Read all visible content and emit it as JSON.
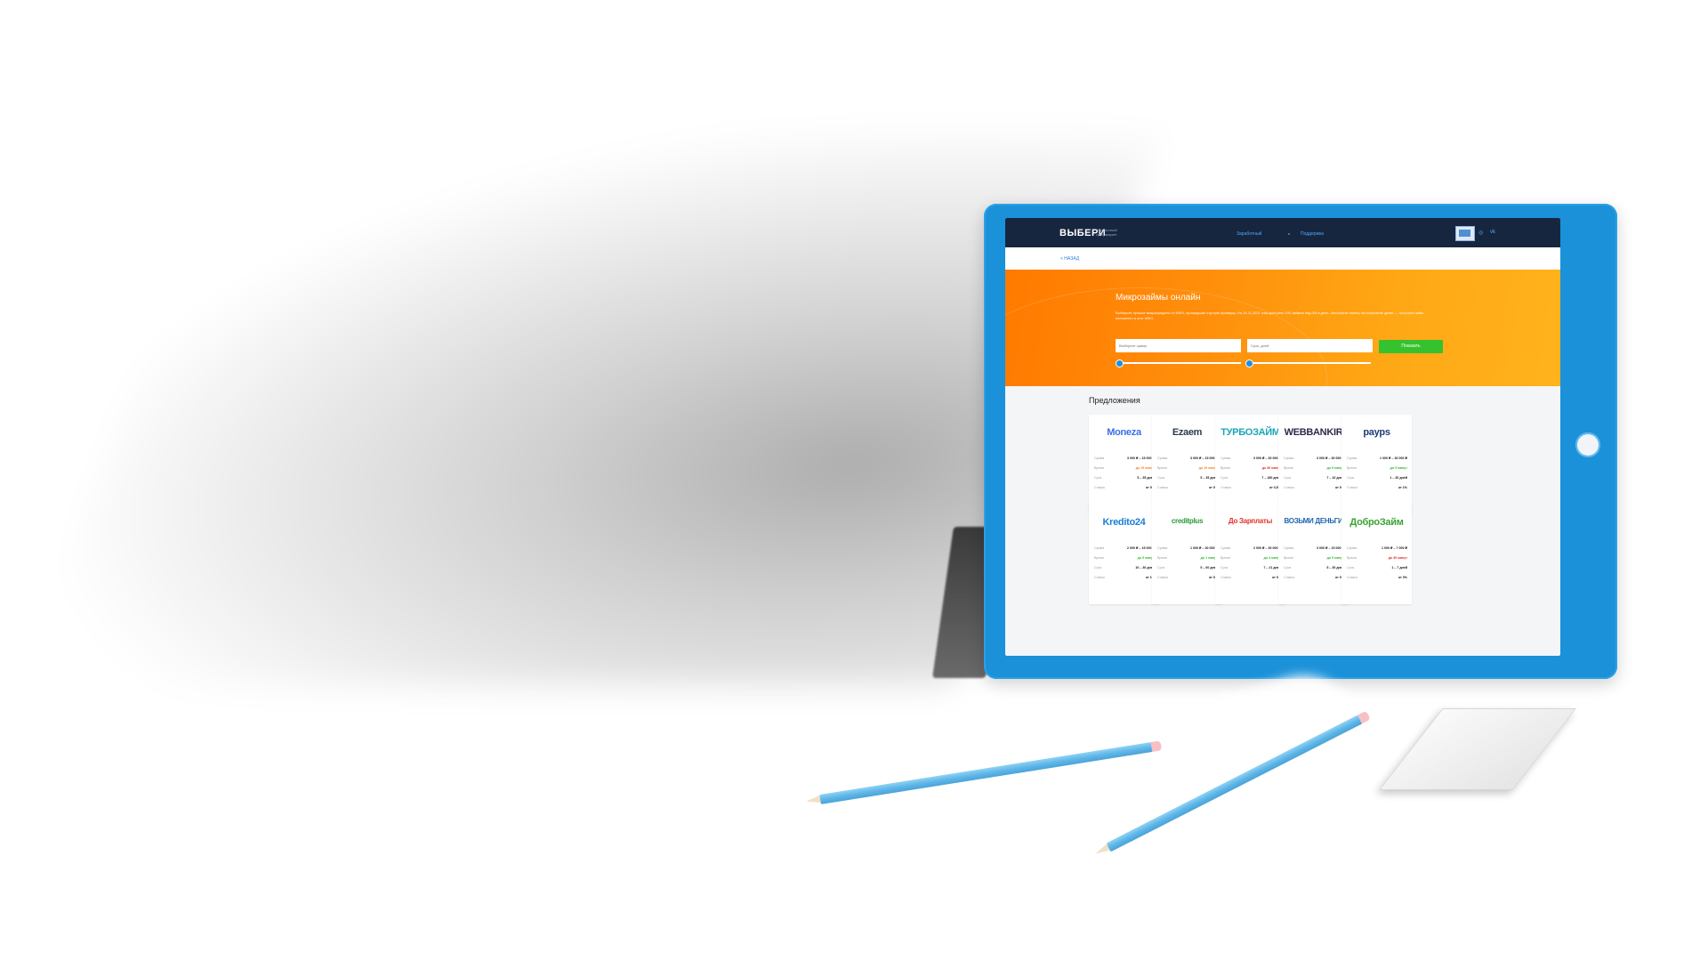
{
  "nav": {
    "logo": "ВЫБЕРИ",
    "logo_sub": "финансовый супермаркет",
    "links": [
      "Заработный",
      "Поддержка"
    ]
  },
  "back_link": "< НАЗАД",
  "hero": {
    "title": "Микрозаймы онлайн",
    "description": "Выберите лучшие микрокредиты от МФО, прошедшие строгую проверку. На 16.11.2021 нам доступно 100 займов под 0% в день. Заполните анкету на получение денег — получите займ мгновенно в этот МФО.",
    "amount_placeholder": "Выберите сумму",
    "term_placeholder": "Срок, дней",
    "show_button": "Показать"
  },
  "offers_title": "Предложения",
  "row_labels": [
    "Сумма",
    "Время",
    "Срок",
    "Ставка"
  ],
  "cards": [
    {
      "logo": "Moneza",
      "logo_color": "#3a6ee8",
      "amount": "3 000 ₽ – 15 000 ₽",
      "time": "до 15 минут",
      "time_color": "orange",
      "term": "5 – 35 дней",
      "rate": "от 0%"
    },
    {
      "logo": "Ezaem",
      "logo_color": "#2a3a4f",
      "amount": "3 000 ₽ – 15 000 ₽",
      "time": "до 15 минут",
      "time_color": "orange",
      "term": "5 – 35 дней",
      "rate": "от 0%"
    },
    {
      "logo": "ТУРБОЗАЙМ",
      "logo_color": "#1aa5b8",
      "amount": "3 000 ₽ – 30 000 ₽",
      "time": "до 30 минут",
      "time_color": "red",
      "term": "7 – 180 дней",
      "rate": "от 0,5%"
    },
    {
      "logo": "WEBBANKIR",
      "logo_color": "#2a2a4a",
      "amount": "3 000 ₽ – 30 000 ₽",
      "time": "до 5 минут",
      "time_color": "green",
      "term": "7 – 10 дней",
      "rate": "от 0%"
    },
    {
      "logo": "payps",
      "logo_color": "#1b3c78",
      "amount": "1 000 ₽ – 30 000 ₽",
      "time": "до 5 минут",
      "time_color": "green",
      "term": "1 – 30 дней",
      "rate": "от 1%"
    },
    {
      "logo": "Kredito24",
      "logo_color": "#1a7fd6",
      "amount": "2 000 ₽ – 15 000 ₽",
      "time": "до 5 минут",
      "time_color": "green",
      "term": "10 – 30 дней",
      "rate": "от 1%"
    },
    {
      "logo": "creditplus",
      "logo_color": "#2a9a3a",
      "amount": "1 000 ₽ – 30 000 ₽",
      "time": "до 1 минут",
      "time_color": "green",
      "term": "5 – 60 дней",
      "rate": "от 0%"
    },
    {
      "logo": "До Зарплаты",
      "logo_color": "#e0322a",
      "amount": "2 000 ₽ – 30 000 ₽",
      "time": "до 4 минут",
      "time_color": "green",
      "term": "7 – 21 дней",
      "rate": "от 0%"
    },
    {
      "logo": "ВОЗЬМИ ДЕНЬГИ",
      "logo_color": "#1f66b0",
      "amount": "3 000 ₽ – 15 000 ₽",
      "time": "до 5 минут",
      "time_color": "green",
      "term": "5 – 30 дней",
      "rate": "от 0%"
    },
    {
      "logo": "ДоброЗайм",
      "logo_color": "#3aa334",
      "amount": "1 000 ₽ – 7 000 ₽",
      "time": "до 30 минут",
      "time_color": "red",
      "term": "1 – 7 дней",
      "rate": "от 0%"
    }
  ],
  "colors": {
    "tablet_frame": "#1a91d9",
    "nav_bg": "#17263f",
    "hero_start": "#ff7a00",
    "hero_end": "#ffb31d",
    "show_button": "#36c22e"
  }
}
